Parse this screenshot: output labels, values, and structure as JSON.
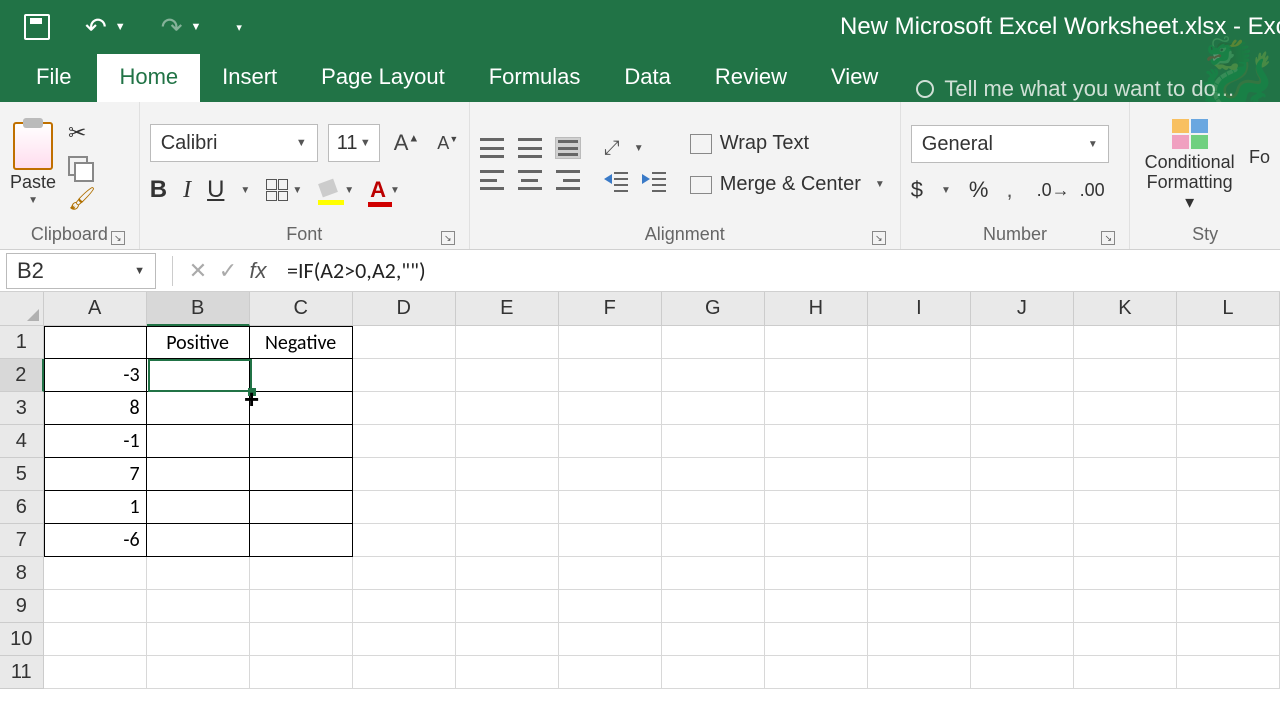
{
  "app": {
    "title": "New Microsoft Excel Worksheet.xlsx - Excel"
  },
  "tabs": {
    "file": "File",
    "home": "Home",
    "insert": "Insert",
    "page_layout": "Page Layout",
    "formulas": "Formulas",
    "data": "Data",
    "review": "Review",
    "view": "View",
    "tellme": "Tell me what you want to do..."
  },
  "ribbon": {
    "clipboard": {
      "label": "Clipboard",
      "paste": "Paste"
    },
    "font": {
      "label": "Font",
      "name": "Calibri",
      "size": "11"
    },
    "alignment": {
      "label": "Alignment",
      "wrap": "Wrap Text",
      "merge": "Merge & Center"
    },
    "number": {
      "label": "Number",
      "format": "General"
    },
    "styles": {
      "label": "Sty",
      "cf1": "Conditional",
      "cf2": "Formatting",
      "fmt": "Fo"
    }
  },
  "namebox": "B2",
  "formula": "=IF(A2>0,A2,\"\")",
  "columns": [
    "A",
    "B",
    "C",
    "D",
    "E",
    "F",
    "G",
    "H",
    "I",
    "J",
    "K",
    "L"
  ],
  "rows": [
    "1",
    "2",
    "3",
    "4",
    "5",
    "6",
    "7",
    "8",
    "9",
    "10",
    "11"
  ],
  "data": {
    "B1": "Positive",
    "C1": "Negative",
    "A2": "-3",
    "A3": "8",
    "A4": "-1",
    "A5": "7",
    "A6": "1",
    "A7": "-6"
  },
  "active_cell": "B2"
}
